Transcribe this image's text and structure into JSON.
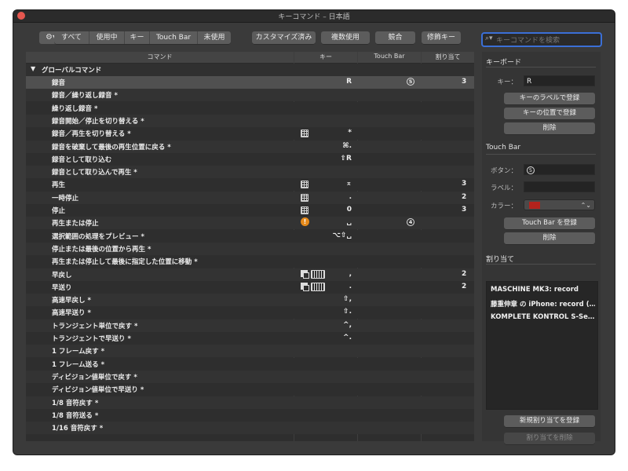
{
  "window": {
    "title": "キーコマンド – 日本語"
  },
  "toolbar": {
    "gear_icon": "gear-icon",
    "filters": [
      "すべて",
      "使用中",
      "キー",
      "Touch Bar",
      "未使用"
    ],
    "buttons": [
      "カスタマイズ済み",
      "複数使用",
      "競合",
      "修飾キー"
    ],
    "search_placeholder": "キーコマンドを検索"
  },
  "table": {
    "headers": {
      "command": "コマンド",
      "key": "キー",
      "touchbar": "Touch Bar",
      "assign": "割り当て"
    },
    "group": "グローバルコマンド",
    "rows": [
      {
        "command": "録音",
        "key": "R",
        "touchbar": "5",
        "assign": "3",
        "icon": ""
      },
      {
        "command": "録音／繰り返し録音 *",
        "key": "",
        "touchbar": "",
        "assign": "",
        "icon": ""
      },
      {
        "command": "繰り返し録音 *",
        "key": "",
        "touchbar": "",
        "assign": "",
        "icon": ""
      },
      {
        "command": "録音開始／停止を切り替える *",
        "key": "",
        "touchbar": "",
        "assign": "",
        "icon": ""
      },
      {
        "command": "録音／再生を切り替える *",
        "key": "*",
        "touchbar": "",
        "assign": "",
        "icon": "grid"
      },
      {
        "command": "録音を破棄して最後の再生位置に戻る *",
        "key": "⌘.",
        "touchbar": "",
        "assign": "",
        "icon": ""
      },
      {
        "command": "録音として取り込む",
        "key": "⇧R",
        "touchbar": "",
        "assign": "",
        "icon": ""
      },
      {
        "command": "録音として取り込んで再生 *",
        "key": "",
        "touchbar": "",
        "assign": "",
        "icon": ""
      },
      {
        "command": "再生",
        "key": "⌅",
        "touchbar": "",
        "assign": "3",
        "icon": "grid"
      },
      {
        "command": "一時停止",
        "key": ".",
        "touchbar": "",
        "assign": "2",
        "icon": "grid"
      },
      {
        "command": "停止",
        "key": "0",
        "touchbar": "",
        "assign": "3",
        "icon": "grid"
      },
      {
        "command": "再生または停止",
        "key": "␣",
        "touchbar": "4",
        "assign": "",
        "icon": "warn"
      },
      {
        "command": "選択範囲の処理をプレビュー *",
        "key": "⌥⇧␣",
        "touchbar": "",
        "assign": "",
        "icon": ""
      },
      {
        "command": "停止または最後の位置から再生 *",
        "key": "",
        "touchbar": "",
        "assign": "",
        "icon": ""
      },
      {
        "command": "再生または停止して最後に指定した位置に移動 *",
        "key": "",
        "touchbar": "",
        "assign": "",
        "icon": ""
      },
      {
        "command": "早戻し",
        "key": ",",
        "touchbar": "",
        "assign": "2",
        "icon": "multi"
      },
      {
        "command": "早送り",
        "key": ".",
        "touchbar": "",
        "assign": "2",
        "icon": "multi"
      },
      {
        "command": "高速早戻し *",
        "key": "⇧,",
        "touchbar": "",
        "assign": "",
        "icon": ""
      },
      {
        "command": "高速早送り *",
        "key": "⇧.",
        "touchbar": "",
        "assign": "",
        "icon": ""
      },
      {
        "command": "トランジェント単位で戻す *",
        "key": "^,",
        "touchbar": "",
        "assign": "",
        "icon": ""
      },
      {
        "command": "トランジェントで早送り *",
        "key": "^.",
        "touchbar": "",
        "assign": "",
        "icon": ""
      },
      {
        "command": "1 フレーム戻す *",
        "key": "",
        "touchbar": "",
        "assign": "",
        "icon": ""
      },
      {
        "command": "1 フレーム送る *",
        "key": "",
        "touchbar": "",
        "assign": "",
        "icon": ""
      },
      {
        "command": "ディビジョン値単位で戻す *",
        "key": "",
        "touchbar": "",
        "assign": "",
        "icon": ""
      },
      {
        "command": "ディビジョン値単位で早送り *",
        "key": "",
        "touchbar": "",
        "assign": "",
        "icon": ""
      },
      {
        "command": "1/8 音符戻す *",
        "key": "",
        "touchbar": "",
        "assign": "",
        "icon": ""
      },
      {
        "command": "1/8 音符送る *",
        "key": "",
        "touchbar": "",
        "assign": "",
        "icon": ""
      },
      {
        "command": "1/16 音符戻す *",
        "key": "",
        "touchbar": "",
        "assign": "",
        "icon": ""
      }
    ]
  },
  "panel": {
    "keyboard": {
      "title": "キーボード",
      "key_label": "キー：",
      "key_value": "R",
      "btn_label_register": "キーのラベルで登録",
      "btn_position_register": "キーの位置で登録",
      "btn_delete": "削除"
    },
    "touchbar": {
      "title": "Touch Bar",
      "button_label": "ボタン：",
      "button_value": "5",
      "label_label": "ラベル：",
      "label_value": "",
      "color_label": "カラー：",
      "color_value": "#b3231d",
      "btn_register": "Touch Bar を登録",
      "btn_delete": "削除"
    },
    "assign": {
      "title": "割り当て",
      "items": [
        "MASCHINE MK3: record",
        "藤重伸章 の iPhone: record (…",
        "KOMPLETE KONTROL S-Se…"
      ],
      "btn_new": "新規割り当てを登録",
      "btn_delete": "割り当てを削除"
    }
  }
}
